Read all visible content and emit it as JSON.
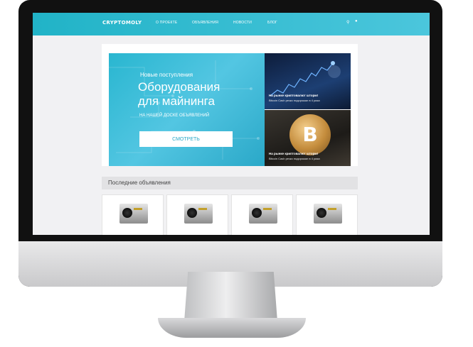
{
  "site": {
    "logo": "CRYPTOMOLY",
    "nav": [
      "О ПРОЕКТЕ",
      "ОБЪЯВЛЕНИЯ",
      "НОВОСТИ",
      "БЛОГ"
    ],
    "icons": {
      "search": "search-icon",
      "user": "user-icon"
    }
  },
  "hero": {
    "subtitle": "Новые поступления",
    "title_line1": "Оборудования",
    "title_line2": "для майнинга",
    "note": "НА НАШЕЙ ДОСКЕ ОБЪЯВЛЕНИЙ",
    "button": "СМОТРЕТЬ"
  },
  "news": [
    {
      "title": "На рынке криптовалют шторм!",
      "desc": "Bitcoin Cash резко подорожал в 4 раза"
    },
    {
      "title": "На рынке криптовалют шторм!",
      "desc": "Bitcoin Cash резко подорожал в 4 раза"
    }
  ],
  "sections": {
    "latest_title": "Последние объявления"
  },
  "products_count_visible": 4,
  "colors": {
    "accent": "#2ab6cd",
    "background": "#f1f1f3"
  }
}
